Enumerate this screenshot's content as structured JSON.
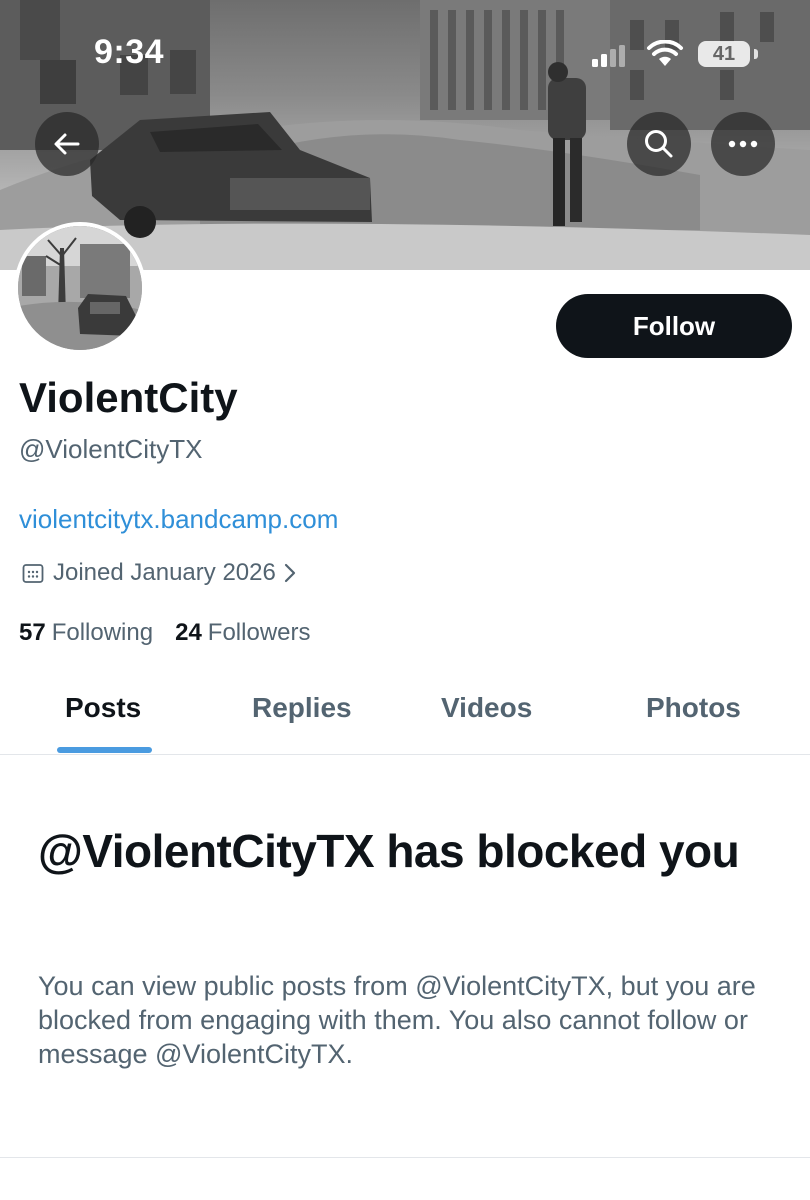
{
  "status_bar": {
    "time": "9:34",
    "battery": "41"
  },
  "header": {
    "back_icon": "arrow-left-icon",
    "search_icon": "search-icon",
    "more_icon": "more-icon"
  },
  "profile": {
    "display_name": "ViolentCity",
    "handle": "@ViolentCityTX",
    "website": "violentcitytx.bandcamp.com",
    "joined": "Joined January 2026",
    "following_count": "57",
    "following_label": "Following",
    "followers_count": "24",
    "followers_label": "Followers",
    "follow_button": "Follow"
  },
  "tabs": [
    {
      "label": "Posts",
      "active": true
    },
    {
      "label": "Replies",
      "active": false
    },
    {
      "label": "Videos",
      "active": false
    },
    {
      "label": "Photos",
      "active": false
    }
  ],
  "blocked_notice": {
    "title": "@ViolentCityTX has blocked you",
    "description": "You can view public posts from @ViolentCityTX, but you are blocked from engaging with them. You also cannot follow or message @ViolentCityTX."
  },
  "colors": {
    "text_primary": "#0f1419",
    "text_secondary": "#536471",
    "link": "#2f8fd8",
    "accent": "#4a9be0",
    "button_dark": "#0f1419"
  }
}
